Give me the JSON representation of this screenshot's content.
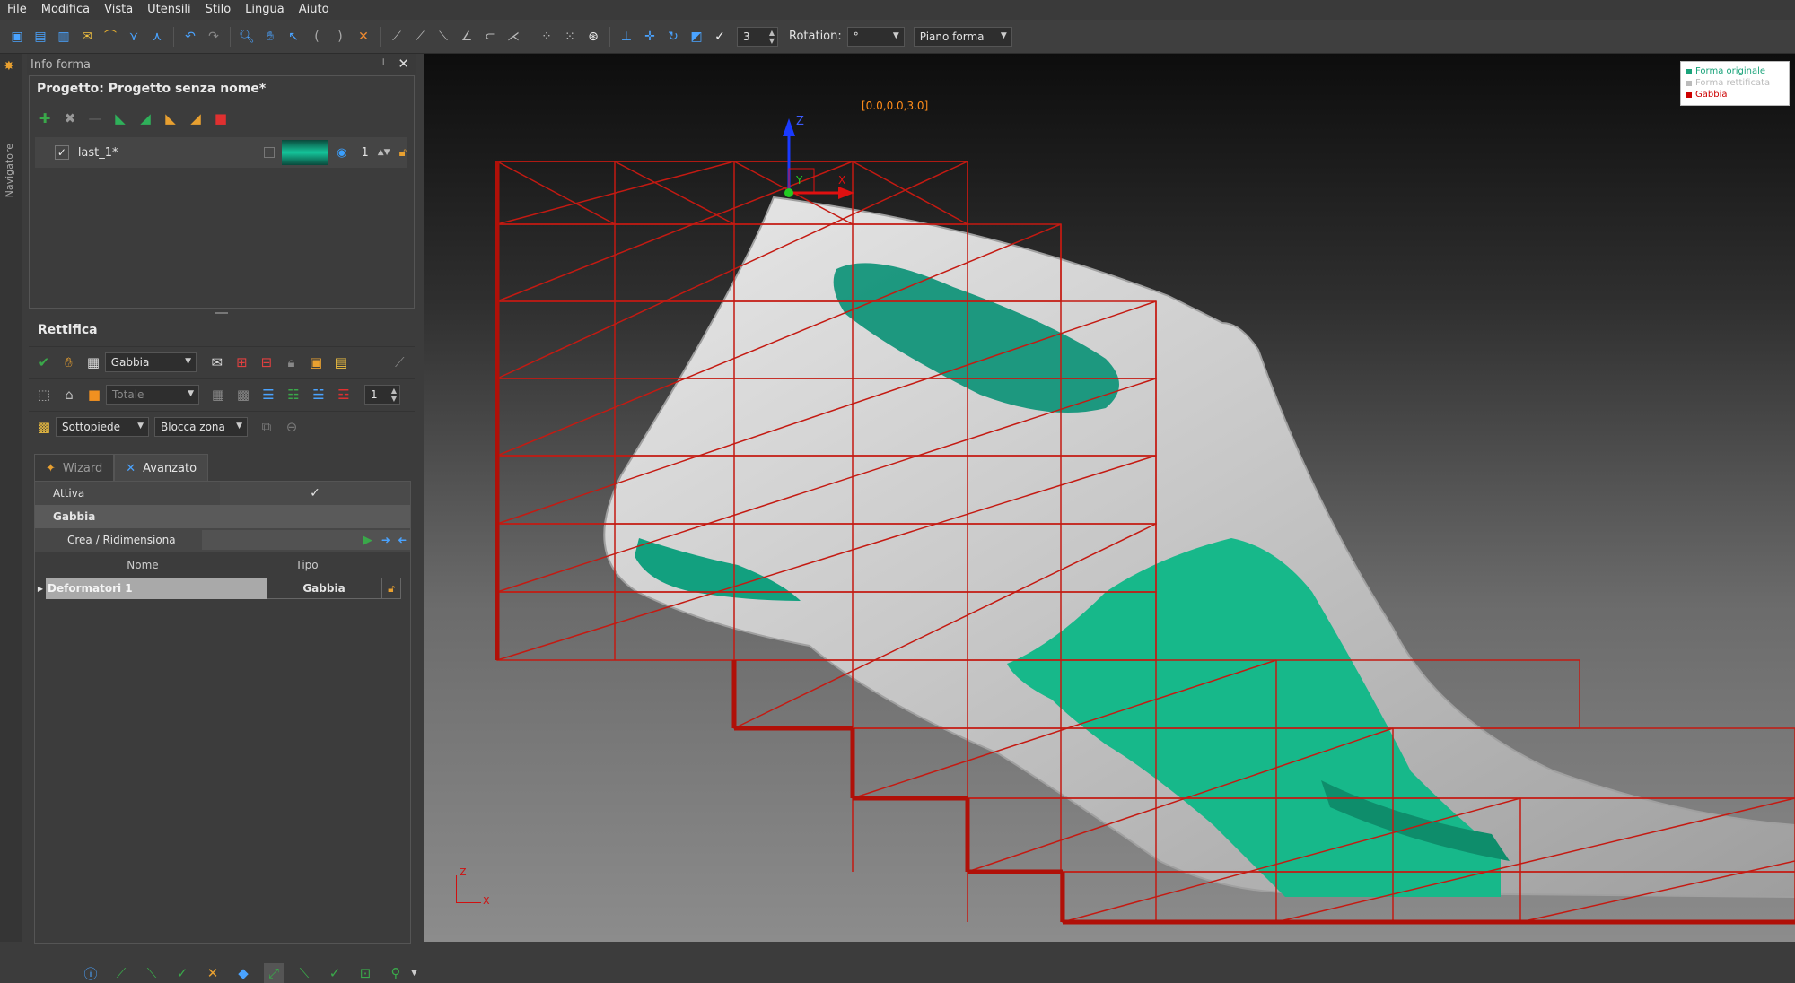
{
  "menu": [
    "File",
    "Modifica",
    "Vista",
    "Utensili",
    "Stilo",
    "Lingua",
    "Aiuto"
  ],
  "toolbar": {
    "segments_value": "3",
    "rotation_label": "Rotation:",
    "rotation_value": "°",
    "plane_value": "Piano forma"
  },
  "navigator_tab": "Navigatore",
  "panel": {
    "title": "Info forma",
    "project_title": "Progetto: Progetto senza nome*",
    "shape": {
      "name": "last_1*",
      "count": "1"
    },
    "rettifica": {
      "title": "Rettifica",
      "mode": "Gabbia",
      "totale": "Totale",
      "stepper": "1",
      "zone1": "Sottopiede",
      "zone2": "Blocca zona"
    },
    "tabs": [
      "Wizard",
      "Avanzato"
    ],
    "props": {
      "attiva": "Attiva",
      "attiva_check": "✓",
      "section": "Gabbia",
      "crea": "Crea / Ridimensiona"
    },
    "table": {
      "col_name": "Nome",
      "col_type": "Tipo",
      "rows": [
        {
          "name": "Deformatori 1",
          "type": "Gabbia"
        }
      ]
    }
  },
  "viewport": {
    "coord": "[0.0,0.0,3.0]",
    "axis_z": "Z",
    "axis_y": "Y",
    "axis_x": "X",
    "legend": [
      {
        "label": "Forma originale",
        "color": "#1aa37a"
      },
      {
        "label": "Forma rettificata",
        "color": "#bbbbbb"
      },
      {
        "label": "Gabbia",
        "color": "#cc0000"
      }
    ]
  },
  "colors": {
    "cage": "#c41a12",
    "green": "#14b88a",
    "shoe": "#cfcfcf"
  }
}
